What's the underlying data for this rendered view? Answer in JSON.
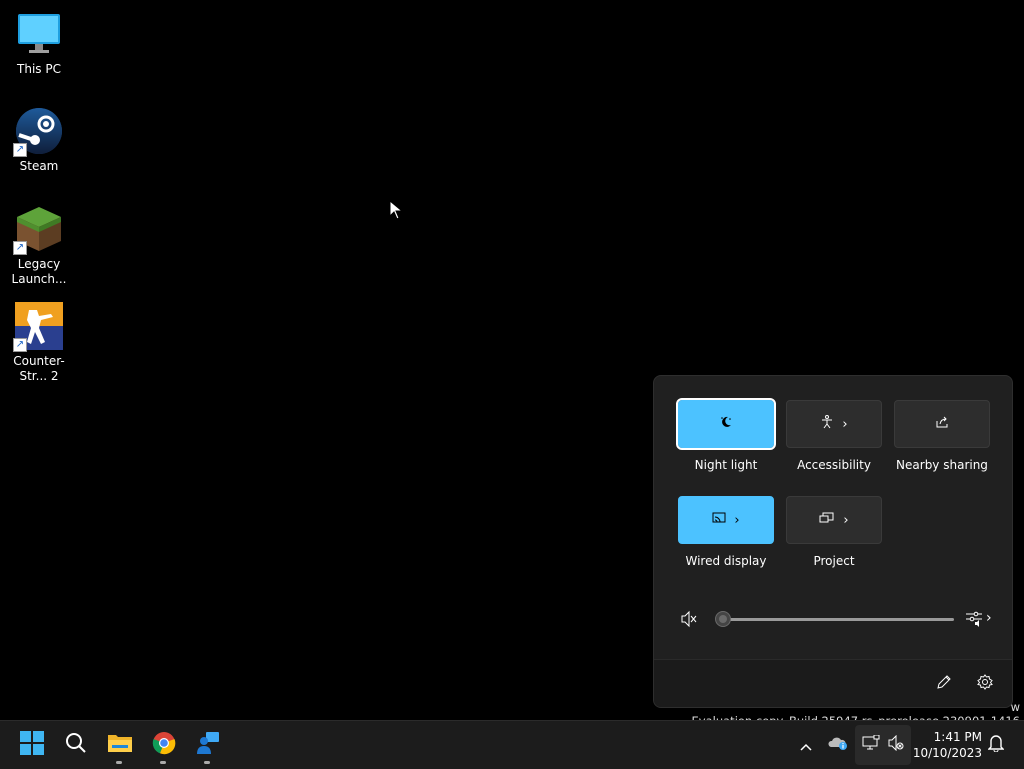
{
  "desktop": {
    "icons": [
      {
        "label": "This PC"
      },
      {
        "label": "Steam"
      },
      {
        "label": "Legacy Launch..."
      },
      {
        "label": "Counter-Str... 2"
      }
    ]
  },
  "quick_settings": {
    "tiles": [
      {
        "label": "Night light",
        "state": "on"
      },
      {
        "label": "Accessibility",
        "state": "off"
      },
      {
        "label": "Nearby sharing",
        "state": "off"
      },
      {
        "label": "Wired display",
        "state": "on"
      },
      {
        "label": "Project",
        "state": "off"
      }
    ],
    "volume": {
      "muted": true,
      "level": 0
    }
  },
  "watermark": {
    "line1": "w",
    "line2": "Evaluation copy. Build 25947.rs_prerelease.230901-1416"
  },
  "taskbar": {
    "time": "1:41 PM",
    "date": "10/10/2023"
  },
  "colors": {
    "accent": "#4cc2ff",
    "taskbar_bg": "#1c1c1c",
    "panel_bg": "#202020"
  }
}
